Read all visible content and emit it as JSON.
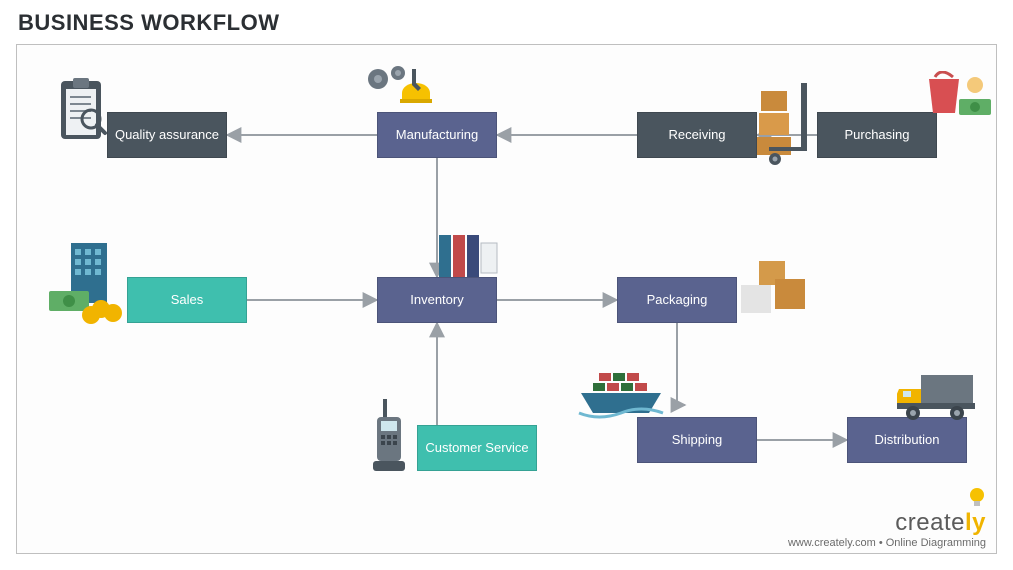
{
  "title": "BUSINESS WORKFLOW",
  "nodes": {
    "quality_assurance": "Quality assurance",
    "manufacturing": "Manufacturing",
    "receiving": "Receiving",
    "purchasing": "Purchasing",
    "sales": "Sales",
    "inventory": "Inventory",
    "packaging": "Packaging",
    "customer_service": "Customer Service",
    "shipping": "Shipping",
    "distribution": "Distribution"
  },
  "branding": {
    "name_part1": "create",
    "name_part2": "ly",
    "tagline_site": "www.creately.com",
    "tagline_dot": " • ",
    "tagline_desc": "Online Diagramming"
  },
  "colors": {
    "indigo": "#5a638f",
    "slate": "#4a555e",
    "teal": "#3fbfae",
    "arrow": "#9aa0a6"
  },
  "icons": {
    "clipboard": "clipboard-magnify-icon",
    "gears": "gears-wrench-icon",
    "handtruck": "hand-truck-boxes-icon",
    "shopping": "hand-bag-money-icon",
    "building": "building-money-icon",
    "binders": "binders-documents-icon",
    "boxes": "packages-icon",
    "phone": "cordless-phone-icon",
    "ship": "cargo-ship-icon",
    "truck": "delivery-truck-icon",
    "bulb": "lightbulb-icon"
  }
}
